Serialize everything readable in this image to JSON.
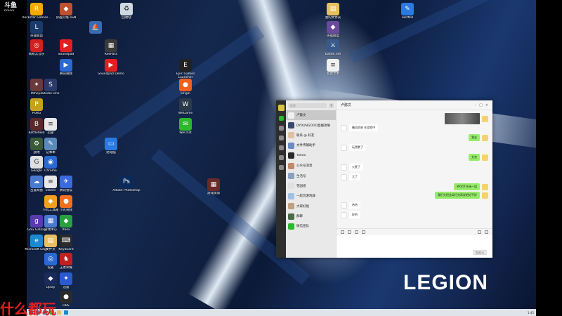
{
  "overlay": {
    "channel_text": "什么都玩",
    "brand": "LEGION"
  },
  "corner_logo": {
    "title": "斗鱼",
    "sub": "DOUYU"
  },
  "desktop_icons": [
    {
      "label": "Rockstar Games...",
      "color": "#f2a900",
      "glyph": "R"
    },
    {
      "label": "穿越火线 eSN",
      "color": "#c05030",
      "glyph": "◆"
    },
    {
      "label": "回收站",
      "color": "#cfd8e0",
      "glyph": "♻"
    },
    {
      "label": "我的文件夹",
      "color": "#e8c060",
      "glyph": "▤"
    },
    {
      "label": "FastMiz",
      "color": "#2a7ae0",
      "glyph": "✎"
    },
    {
      "label": "英雄联盟",
      "color": "#1a3a6a",
      "glyph": "L"
    },
    {
      "label": "",
      "color": "#3a6ab0",
      "glyph": "⛵"
    },
    {
      "label": "英雄联盟",
      "color": "#6a4a9a",
      "glyph": "◆"
    },
    {
      "label": "网易云音乐",
      "color": "#d02020",
      "glyph": "◎"
    },
    {
      "label": "Soundpad",
      "color": "#e02020",
      "glyph": "▶"
    },
    {
      "label": "KeePass",
      "color": "#3a3a3a",
      "glyph": "▦"
    },
    {
      "label": "Battle.net",
      "color": "#3a5a8a",
      "glyph": "⚔"
    },
    {
      "label": "腾讯视频",
      "color": "#2a6ad0",
      "glyph": "▶"
    },
    {
      "label": "Soundpad Demo",
      "color": "#e02020",
      "glyph": "▶"
    },
    {
      "label": "Epic Games Launcher",
      "color": "#222",
      "glyph": "E"
    },
    {
      "label": "新建文本",
      "color": "#f0f0f0",
      "glyph": "≡"
    },
    {
      "label": "Mihoyo",
      "color": "#6a3a3a",
      "glyph": "✦"
    },
    {
      "label": "Studio One",
      "color": "#2a3a6a",
      "glyph": "S"
    },
    {
      "label": "Origin",
      "color": "#f06020",
      "glyph": "●"
    },
    {
      "label": "PUBG",
      "color": "#c8a020",
      "glyph": "P"
    },
    {
      "label": "WeGame",
      "color": "#2a3a4a",
      "glyph": "W"
    },
    {
      "label": "Battlefield",
      "color": "#5a2a2a",
      "glyph": "B"
    },
    {
      "label": "迅雷",
      "color": "#e8e8e8",
      "glyph": "≡"
    },
    {
      "label": "WeChat",
      "color": "#2eb82e",
      "glyph": "✉"
    },
    {
      "label": "战地",
      "color": "#3a5a3a",
      "glyph": "⚙"
    },
    {
      "label": "记事本",
      "color": "#5a8aba",
      "glyph": "✎"
    },
    {
      "label": "此电脑",
      "color": "#2a7ae0",
      "glyph": "▭"
    },
    {
      "label": "Google",
      "color": "#e0e0e0",
      "glyph": "G"
    },
    {
      "label": "Adobe Photoshop",
      "color": "#0a2a5a",
      "glyph": "Ps"
    },
    {
      "label": "Chrome",
      "color": "#2a6ad0",
      "glyph": "◉"
    },
    {
      "label": "百度网盘",
      "color": "#4a7ad0",
      "glyph": "☁"
    },
    {
      "label": "腾讯会议",
      "color": "#3a6ae0",
      "glyph": "✈"
    },
    {
      "label": "游戏加加",
      "color": "#6a2a2a",
      "glyph": "▦"
    },
    {
      "label": "Steam",
      "color": "#e8e8e8",
      "glyph": "≡"
    },
    {
      "label": "小丸工具箱",
      "color": "#f0a020",
      "glyph": "◆"
    },
    {
      "label": "小丸视频",
      "color": "#f07020",
      "glyph": "●"
    },
    {
      "label": "GoG Galaxy",
      "color": "#5a3ab0",
      "glyph": "g"
    },
    {
      "label": "游戏中心",
      "color": "#4a7ad0",
      "glyph": "▦"
    },
    {
      "label": "Xbox",
      "color": "#2aa040",
      "glyph": "◆"
    },
    {
      "label": "Microsoft Edge",
      "color": "#1a8ad0",
      "glyph": "e"
    },
    {
      "label": "文件夹",
      "color": "#e8c060",
      "glyph": "▤"
    },
    {
      "label": "Keyboard",
      "color": "#2a2a2a",
      "glyph": "⌨"
    },
    {
      "label": "设置",
      "color": "#2a6ad0",
      "glyph": "◎"
    },
    {
      "label": "王者荣耀",
      "color": "#c02020",
      "glyph": "♞"
    },
    {
      "label": "Uplay",
      "color": "#1a2a5a",
      "glyph": "◆"
    },
    {
      "label": "迅雷",
      "color": "#2a5ad0",
      "glyph": "✦"
    },
    {
      "label": "OBS",
      "color": "#2a2a2a",
      "glyph": "●"
    }
  ],
  "chat": {
    "window_title": "卢懿文",
    "search_placeholder": "搜索",
    "conversations": [
      {
        "name": "卢懿文",
        "preview": "",
        "time": ""
      },
      {
        "name": "DYOUNGOOO直播攻略",
        "preview": "",
        "time": ""
      },
      {
        "name": "联系 @ 好友",
        "preview": "",
        "time": ""
      },
      {
        "name": "文件传输助手",
        "preview": "",
        "time": ""
      },
      {
        "name": "Yahoo",
        "preview": "",
        "time": ""
      },
      {
        "name": "公众号消息",
        "preview": "",
        "time": ""
      },
      {
        "name": "生活号",
        "preview": "",
        "time": ""
      },
      {
        "name": "花园组",
        "preview": "",
        "time": ""
      },
      {
        "name": "一起玩游戏群",
        "preview": "",
        "time": ""
      },
      {
        "name": "大家好组",
        "preview": "",
        "time": ""
      },
      {
        "name": "群聊",
        "preview": "",
        "time": ""
      },
      {
        "name": "微信团队",
        "preview": "",
        "time": ""
      }
    ],
    "messages": [
      {
        "side": "left",
        "text": "撤回消息 在游戏中"
      },
      {
        "side": "right",
        "text": "我去"
      },
      {
        "side": "left",
        "text": "玩得累了"
      },
      {
        "side": "right",
        "text": "艾克"
      },
      {
        "side": "left",
        "text": "火麦了"
      },
      {
        "side": "left",
        "text": "大了"
      },
      {
        "side": "right",
        "text": "WOOT开始一局"
      },
      {
        "side": "right",
        "text": "我们先把这局打完再说吧好不好"
      },
      {
        "side": "left",
        "text": "哈哈"
      },
      {
        "side": "left",
        "text": "好的"
      }
    ],
    "send_label": "发送(S)"
  },
  "taskbar": {
    "clock": "1:45"
  }
}
